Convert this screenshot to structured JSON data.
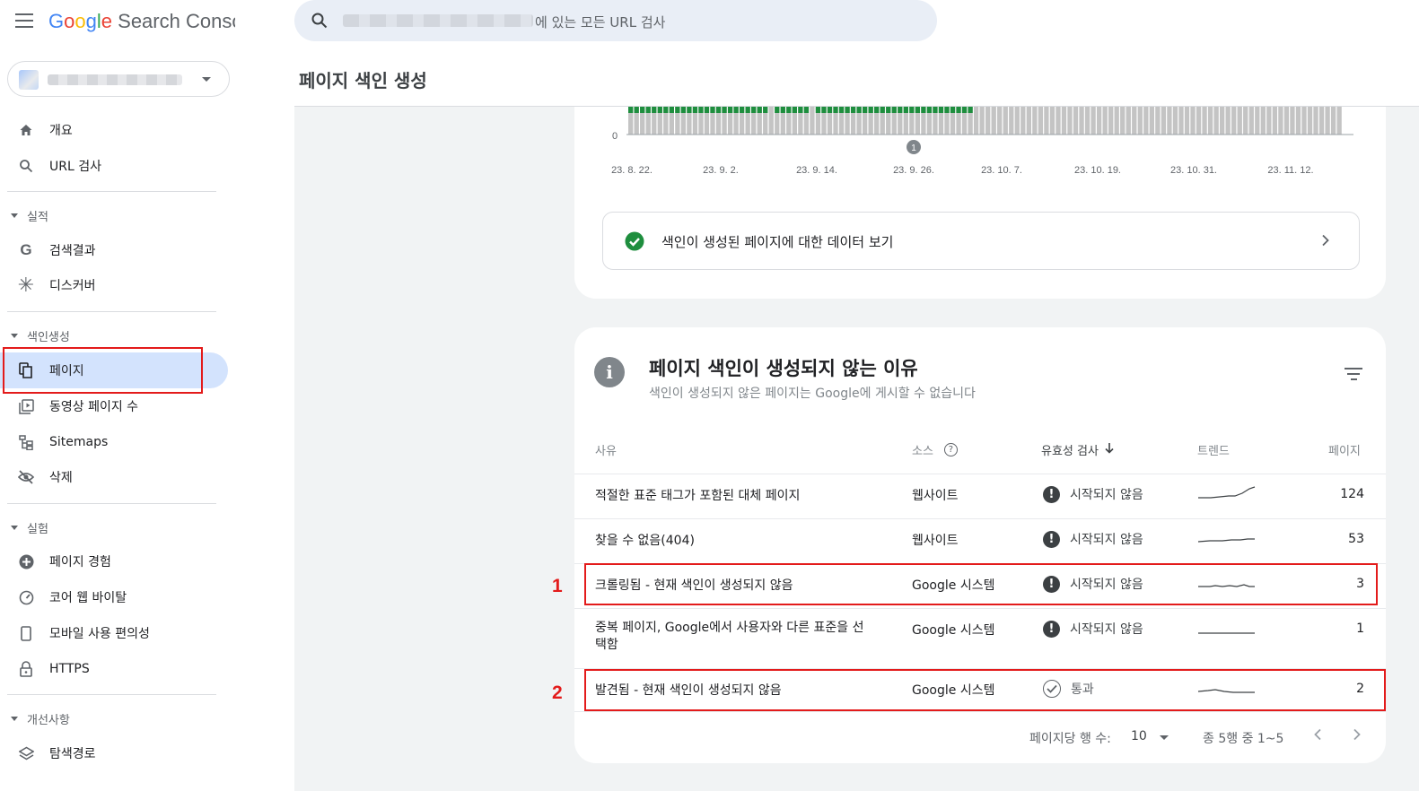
{
  "app": {
    "logo_google": "Google",
    "logo_product": "Search Console"
  },
  "search": {
    "placeholder_suffix": "에 있는 모든 URL 검사"
  },
  "page_title": "페이지 색인 생성",
  "sidebar": {
    "items_top": [
      {
        "label": "개요",
        "icon": "home-icon"
      },
      {
        "label": "URL 검사",
        "icon": "search-icon"
      }
    ],
    "sections": [
      {
        "title": "실적",
        "items": [
          {
            "label": "검색결과",
            "icon": "google-g-icon"
          },
          {
            "label": "디스커버",
            "icon": "asterisk-icon"
          }
        ]
      },
      {
        "title": "색인생성",
        "items": [
          {
            "label": "페이지",
            "icon": "pages-icon",
            "active": true
          },
          {
            "label": "동영상 페이지 수",
            "icon": "video-pages-icon"
          },
          {
            "label": "Sitemaps",
            "icon": "sitemap-icon"
          },
          {
            "label": "삭제",
            "icon": "eye-off-icon"
          }
        ]
      },
      {
        "title": "실험",
        "items": [
          {
            "label": "페이지 경험",
            "icon": "plus-circle-icon"
          },
          {
            "label": "코어 웹 바이탈",
            "icon": "gauge-icon"
          },
          {
            "label": "모바일 사용 편의성",
            "icon": "phone-icon"
          },
          {
            "label": "HTTPS",
            "icon": "lock-icon"
          }
        ]
      },
      {
        "title": "개선사항",
        "items": [
          {
            "label": "탐색경로",
            "icon": "layers-icon"
          }
        ]
      }
    ]
  },
  "chart_data": {
    "type": "bar",
    "y_tick_visible": "0",
    "x_tick_labels": [
      "23. 8. 22.",
      "23. 9. 2.",
      "23. 9. 14.",
      "23. 9. 26.",
      "23. 10. 7.",
      "23. 10. 19.",
      "23. 10. 31.",
      "23. 11. 12."
    ],
    "annotation_marker": "1",
    "series_colors": {
      "indexed": "#1e8e3e",
      "not_indexed": "#c4c4c4"
    }
  },
  "indexed_link": {
    "label": "색인이 생성된 페이지에 대한 데이터 보기"
  },
  "reasons": {
    "title": "페이지 색인이 생성되지 않는 이유",
    "subtitle": "색인이 생성되지 않은 페이지는 Google에 게시할 수 없습니다",
    "headers": {
      "reason": "사유",
      "source": "소스",
      "validation": "유효성 검사",
      "trend": "트렌드",
      "pages": "페이지"
    },
    "rows": [
      {
        "reason": "적절한 표준 태그가 포함된 대체 페이지",
        "source": "웹사이트",
        "status": "시작되지 않음",
        "status_type": "not_started",
        "pages": "124"
      },
      {
        "reason": "찾을 수 없음(404)",
        "source": "웹사이트",
        "status": "시작되지 않음",
        "status_type": "not_started",
        "pages": "53"
      },
      {
        "reason": "크롤링됨 - 현재 색인이 생성되지 않음",
        "source": "Google 시스템",
        "status": "시작되지 않음",
        "status_type": "not_started",
        "pages": "3"
      },
      {
        "reason": "중복 페이지, Google에서 사용자와 다른 표준을 선택함",
        "source": "Google 시스템",
        "status": "시작되지 않음",
        "status_type": "not_started",
        "pages": "1"
      },
      {
        "reason": "발견됨 - 현재 색인이 생성되지 않음",
        "source": "Google 시스템",
        "status": "통과",
        "status_type": "passed",
        "pages": "2"
      }
    ],
    "pager": {
      "rows_per_page_label": "페이지당 행 수:",
      "rows_per_page_value": "10",
      "range_label": "종 5행 중 1~5"
    }
  },
  "annotations": {
    "first": "1",
    "second": "2"
  }
}
